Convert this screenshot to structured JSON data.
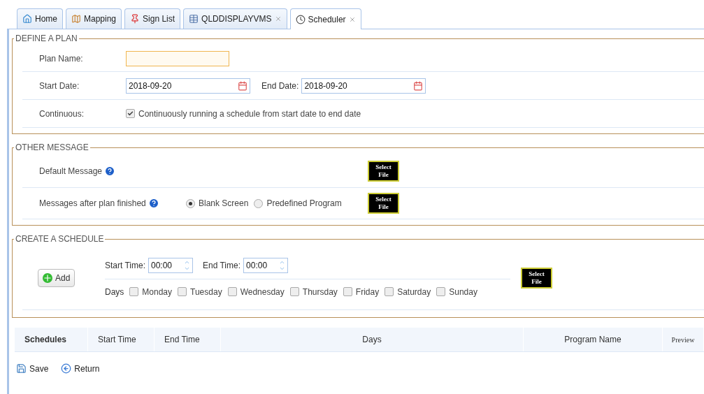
{
  "tabs": [
    {
      "label": "Home",
      "selected": false,
      "closable": false
    },
    {
      "label": "Mapping",
      "selected": false,
      "closable": false
    },
    {
      "label": "Sign List",
      "selected": false,
      "closable": false
    },
    {
      "label": "QLDDISPLAYVMS",
      "selected": false,
      "closable": true
    },
    {
      "label": "Scheduler",
      "selected": true,
      "closable": true
    }
  ],
  "define_plan": {
    "legend": "DEFINE A PLAN",
    "plan_name_label": "Plan Name:",
    "start_date_label": "Start Date:",
    "start_date": "2018-09-20",
    "end_date_label": "End Date:",
    "end_date": "2018-09-20",
    "continuous_label": "Continuous:",
    "continuous": {
      "label": "Continuously running a schedule from start date to end date",
      "checked": true
    }
  },
  "other_message": {
    "legend": "OTHER MESSAGE",
    "default_message_label": "Default Message",
    "default_select": "Select File",
    "after_label": "Messages after plan finished",
    "options": [
      {
        "label": "Blank Screen",
        "selected": true
      },
      {
        "label": "Predefined Program",
        "selected": false
      }
    ],
    "after_select": "Select File"
  },
  "create_schedule": {
    "legend": "CREATE A SCHEDULE",
    "add_button": "Add",
    "start_time_label": "Start Time:",
    "start_time": "00:00",
    "end_time_label": "End Time:",
    "end_time": "00:00",
    "days_label": "Days",
    "days": [
      {
        "label": "Monday",
        "checked": false
      },
      {
        "label": "Tuesday",
        "checked": false
      },
      {
        "label": "Wednesday",
        "checked": false
      },
      {
        "label": "Thursday",
        "checked": false
      },
      {
        "label": "Friday",
        "checked": false
      },
      {
        "label": "Saturday",
        "checked": false
      },
      {
        "label": "Sunday",
        "checked": false
      }
    ],
    "select_file": "Select File"
  },
  "table": {
    "columns": [
      "Schedules",
      "Start Time",
      "End Time",
      "Days",
      "Program Name",
      "Preview"
    ]
  },
  "footer": {
    "save": "Save",
    "return": "Return"
  }
}
